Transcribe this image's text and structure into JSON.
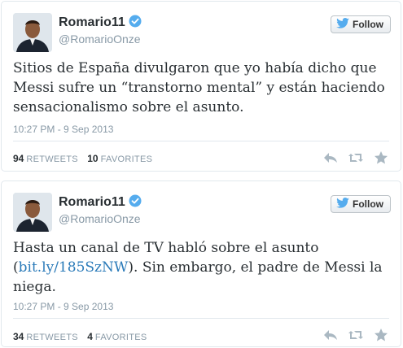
{
  "colors": {
    "link": "#2b7bb9",
    "verified": "#55acee",
    "muted": "#8899a6",
    "text": "#292f33"
  },
  "tweets": [
    {
      "name": "Romario11",
      "handle": "@RomarioOnze",
      "follow_label": "Follow",
      "text_parts": [
        "Sitios de España divulgaron que yo había dicho que Messi sufre un “transtorno mental” y están haciendo sensacionalismo sobre el asunto."
      ],
      "timestamp": "10:27 PM - 9 Sep 2013",
      "retweets": "94",
      "retweets_label": "RETWEETS",
      "favorites": "10",
      "favorites_label": "FAVORITES",
      "icons": [
        "reply-icon",
        "retweet-icon",
        "favorite-icon"
      ]
    },
    {
      "name": "Romario11",
      "handle": "@RomarioOnze",
      "follow_label": "Follow",
      "text_before": "Hasta un canal de TV habló sobre el asunto (",
      "link": "bit.ly/185SzNW",
      "text_after": "). Sin embargo, el  padre de Messi la niega.",
      "timestamp": "10:27 PM - 9 Sep 2013",
      "retweets": "34",
      "retweets_label": "RETWEETS",
      "favorites": "4",
      "favorites_label": "FAVORITES",
      "icons": [
        "reply-icon",
        "retweet-icon",
        "favorite-icon"
      ]
    }
  ]
}
